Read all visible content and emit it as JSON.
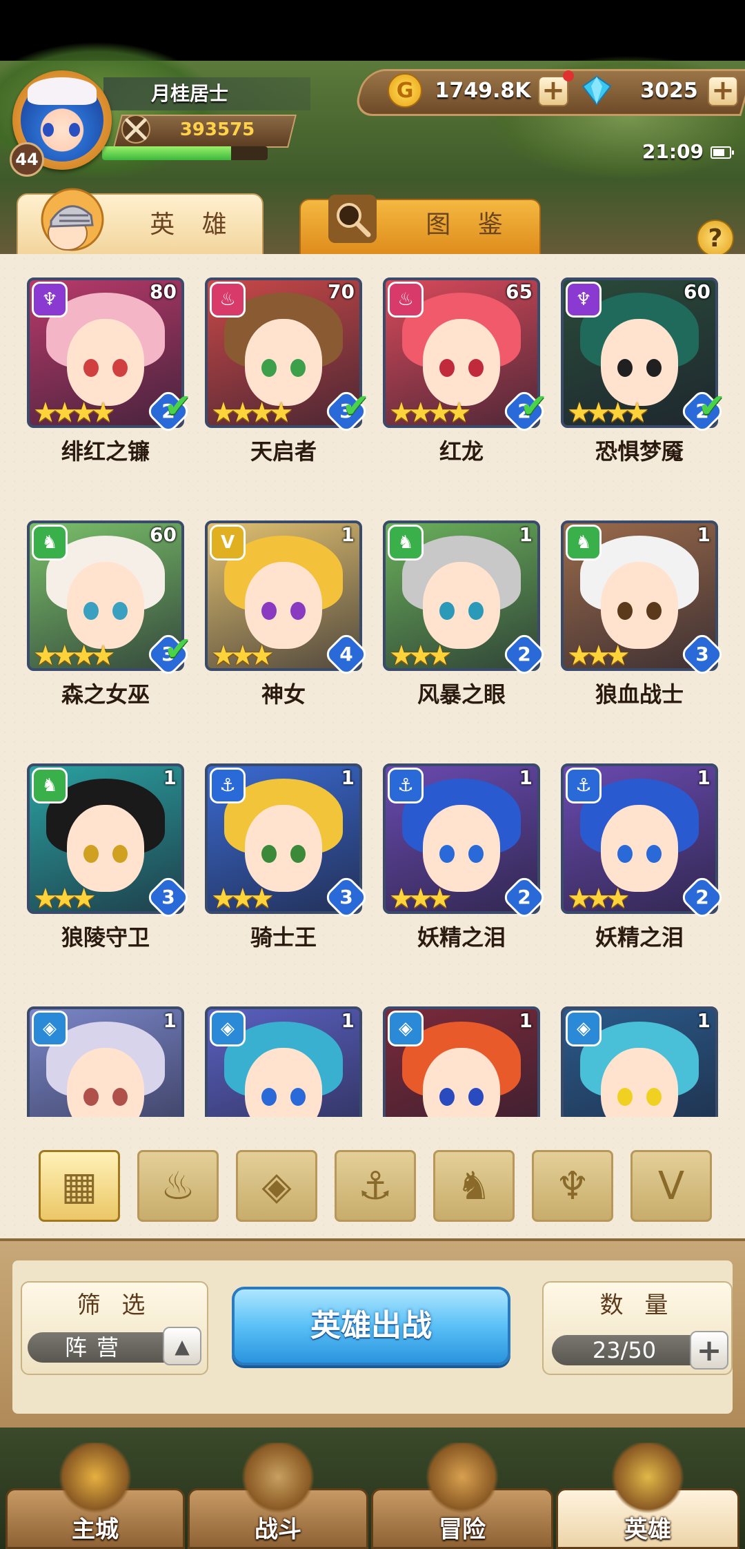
{
  "player": {
    "name": "月桂居士",
    "level": "44",
    "power": "393575",
    "exp_fraction": 0.78
  },
  "currency": {
    "gold": "1749.8K",
    "gems": "3025",
    "gold_icon_glyph": "G"
  },
  "status": {
    "time": "21:09"
  },
  "tabs": {
    "hero": "英 雄",
    "atlas": "图 鉴"
  },
  "help_label": "?",
  "heroes": [
    {
      "name": "绯红之镰",
      "level": "80",
      "stars": "★★★★",
      "rank": "2",
      "deployed": true,
      "class": "demon",
      "hair": "#f4b6c6",
      "eye": "#d04040",
      "bg": "#b83a6a"
    },
    {
      "name": "天启者",
      "level": "70",
      "stars": "★★★★",
      "rank": "3",
      "deployed": true,
      "class": "mage",
      "hair": "#8a5a32",
      "eye": "#3ca04a",
      "bg": "#c84848"
    },
    {
      "name": "红龙",
      "level": "65",
      "stars": "★★★★",
      "rank": "2",
      "deployed": true,
      "class": "mage",
      "hair": "#f05a6a",
      "eye": "#c02a3a",
      "bg": "#d84a5a"
    },
    {
      "name": "恐惧梦魇",
      "level": "60",
      "stars": "★★★★",
      "rank": "2",
      "deployed": true,
      "class": "demon",
      "hair": "#1f6a5a",
      "eye": "#202020",
      "bg": "#2a4a3a"
    },
    {
      "name": "森之女巫",
      "level": "60",
      "stars": "★★★★",
      "rank": "3",
      "deployed": true,
      "class": "beast",
      "hair": "#f6efe8",
      "eye": "#3aa0c0",
      "bg": "#7ac06a"
    },
    {
      "name": "神女",
      "level": "1",
      "stars": "★★★",
      "rank": "4",
      "deployed": false,
      "class": "divine",
      "hair": "#f4c23a",
      "eye": "#8a3ac0",
      "bg": "#e0c070"
    },
    {
      "name": "风暴之眼",
      "level": "1",
      "stars": "★★★",
      "rank": "2",
      "deployed": false,
      "class": "beast",
      "hair": "#c8c8c8",
      "eye": "#2a9ab8",
      "bg": "#6ab05a"
    },
    {
      "name": "狼血战士",
      "level": "1",
      "stars": "★★★",
      "rank": "3",
      "deployed": false,
      "class": "beast",
      "hair": "#f2f2f2",
      "eye": "#5a3a1a",
      "bg": "#9a6a4a"
    },
    {
      "name": "狼陵守卫",
      "level": "1",
      "stars": "★★★",
      "rank": "3",
      "deployed": false,
      "class": "beast",
      "hair": "#1a1a1a",
      "eye": "#d0a020",
      "bg": "#2aa0a0"
    },
    {
      "name": "骑士王",
      "level": "1",
      "stars": "★★★",
      "rank": "3",
      "deployed": false,
      "class": "anchor",
      "hair": "#f2c43a",
      "eye": "#3a8a3a",
      "bg": "#3a6ad0"
    },
    {
      "name": "妖精之泪",
      "level": "1",
      "stars": "★★★",
      "rank": "2",
      "deployed": false,
      "class": "anchor",
      "hair": "#2a5ad0",
      "eye": "#2a6ad8",
      "bg": "#6a4ab0"
    },
    {
      "name": "妖精之泪",
      "level": "1",
      "stars": "★★★",
      "rank": "2",
      "deployed": false,
      "class": "anchor",
      "hair": "#2a5ad0",
      "eye": "#2a6ad8",
      "bg": "#6a4ab0"
    },
    {
      "name": "",
      "level": "1",
      "stars": "",
      "rank": "",
      "deployed": false,
      "class": "gem",
      "hair": "#d8d4ec",
      "eye": "#b0504a",
      "bg": "#7a86c8"
    },
    {
      "name": "",
      "level": "1",
      "stars": "",
      "rank": "",
      "deployed": false,
      "class": "gem",
      "hair": "#3ab0d0",
      "eye": "#2a6ad8",
      "bg": "#5a60c0"
    },
    {
      "name": "",
      "level": "1",
      "stars": "",
      "rank": "",
      "deployed": false,
      "class": "gem",
      "hair": "#e85a2a",
      "eye": "#2a4ac0",
      "bg": "#7a2a3a"
    },
    {
      "name": "",
      "level": "1",
      "stars": "",
      "rank": "",
      "deployed": false,
      "class": "gem",
      "hair": "#4ac0d8",
      "eye": "#f0d020",
      "bg": "#2a5a8a"
    }
  ],
  "class_colors": {
    "demon": "#8a3ad0",
    "mage": "#d83a6a",
    "beast": "#3ab04a",
    "divine": "#e0b020",
    "anchor": "#2a6ad8",
    "gem": "#2a8ad8"
  },
  "class_glyphs": {
    "demon": "♆",
    "mage": "♨",
    "beast": "♞",
    "divine": "V",
    "anchor": "⚓",
    "gem": "◈"
  },
  "filter_tabs": [
    {
      "name": "all",
      "glyph": "▦",
      "active": true
    },
    {
      "name": "flame",
      "glyph": "♨",
      "active": false
    },
    {
      "name": "gem",
      "glyph": "◈",
      "active": false
    },
    {
      "name": "anchor",
      "glyph": "⚓",
      "active": false
    },
    {
      "name": "wolf",
      "glyph": "♞",
      "active": false
    },
    {
      "name": "demon",
      "glyph": "♆",
      "active": false
    },
    {
      "name": "divine",
      "glyph": "V",
      "active": false
    }
  ],
  "controls": {
    "filter_title": "筛 选",
    "filter_value": "阵营",
    "toggle_glyph": "▲",
    "battle_label": "英雄出战",
    "count_title": "数 量",
    "count_value": "23/50",
    "plus_glyph": "+"
  },
  "nav": [
    {
      "name": "main-city",
      "label": "主城",
      "active": false
    },
    {
      "name": "battle",
      "label": "战斗",
      "active": false
    },
    {
      "name": "adventure",
      "label": "冒险",
      "active": false
    },
    {
      "name": "heroes",
      "label": "英雄",
      "active": true
    }
  ]
}
